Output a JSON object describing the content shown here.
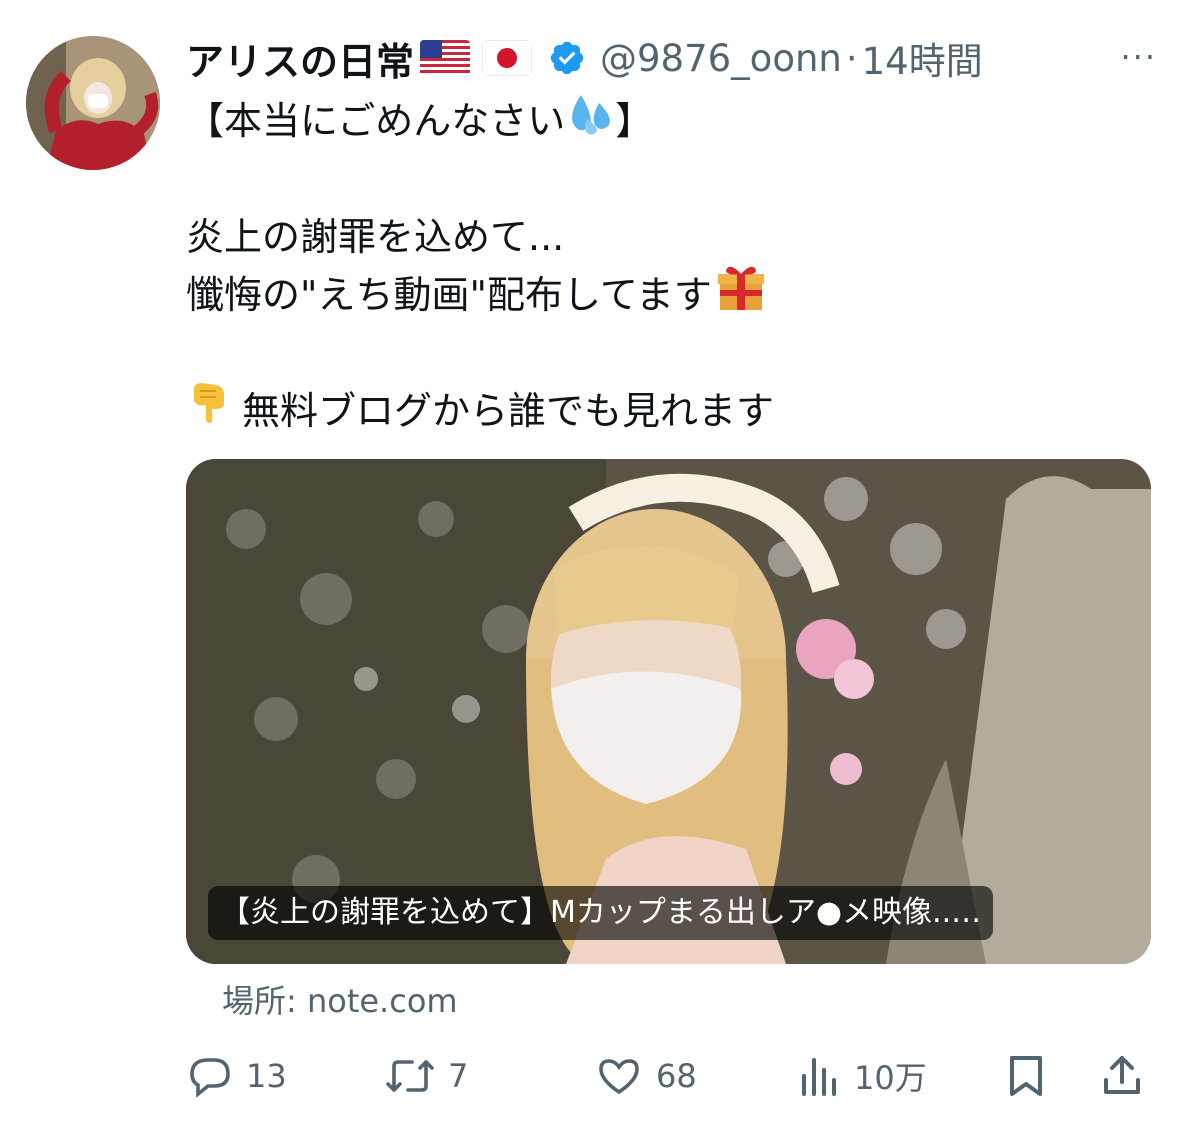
{
  "tweet": {
    "display_name": "アリスの日常",
    "flags": [
      "us-flag-emoji",
      "japan-flag-emoji"
    ],
    "verified": true,
    "handle": "@9876_oonn",
    "separator": "·",
    "time": "14時間",
    "more": "···",
    "lines": [
      "【本当にごめんなさい",
      "】",
      "炎上の謝罪を込めて...",
      "懺悔の\"えち動画\"配布してます",
      "無料ブログから誰でも見れます"
    ],
    "emojis": [
      "sweat-droplets-emoji",
      "gift-emoji",
      "pointing-down-emoji"
    ]
  },
  "card": {
    "title": "【炎上の謝罪を込めて】Mカップまる出しア●メ映像..…",
    "source": "場所: note.com"
  },
  "actions": {
    "replies": "13",
    "retweets": "7",
    "likes": "68",
    "views": "10万"
  },
  "colors": {
    "text": "#0f1419",
    "secondary": "#536471",
    "verified": "#1d9bf0"
  }
}
